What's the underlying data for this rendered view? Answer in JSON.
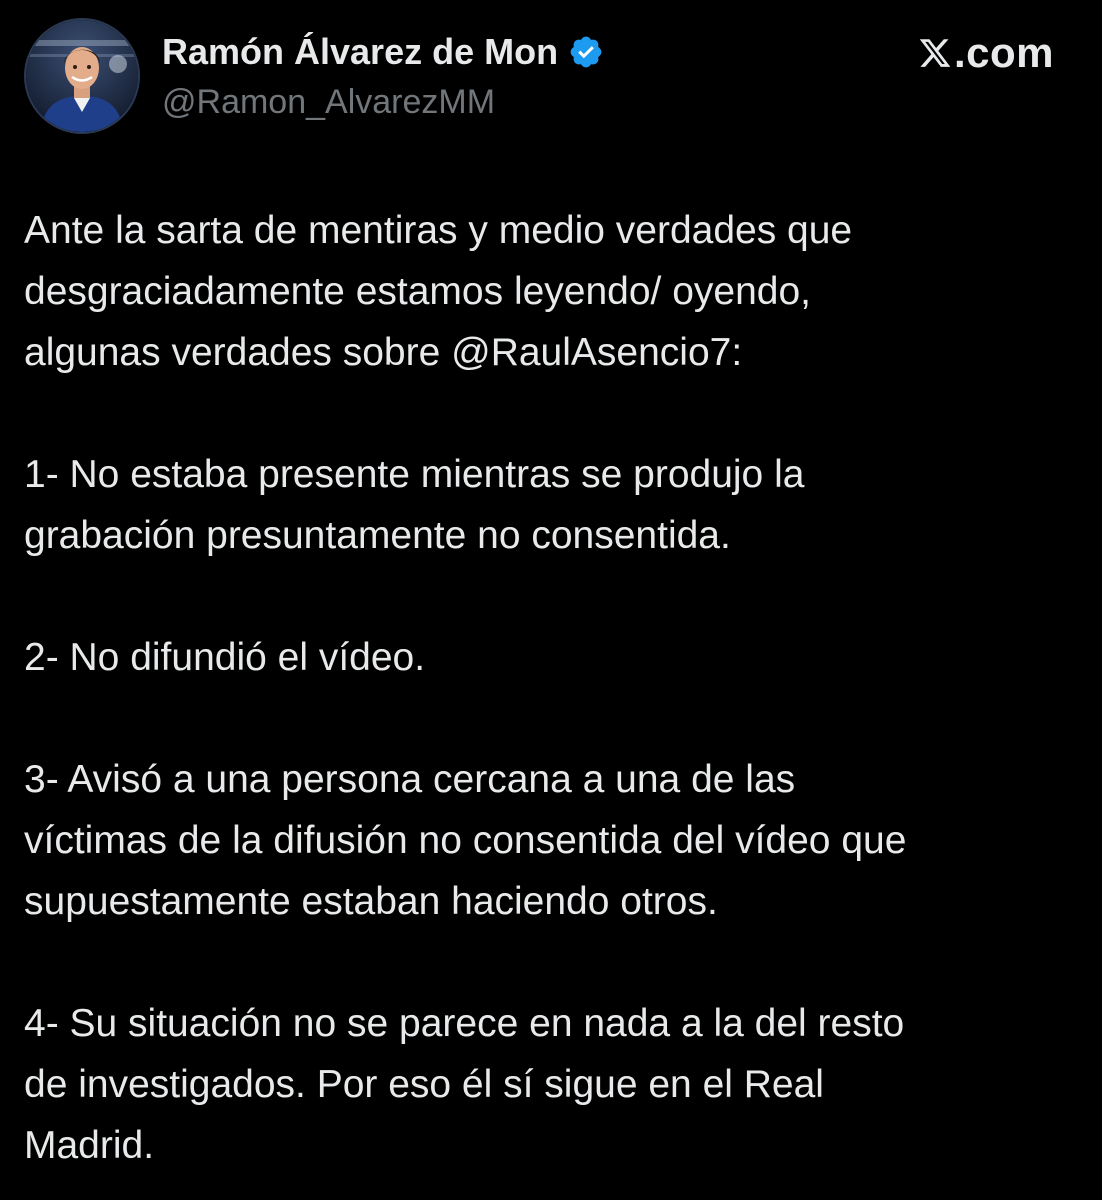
{
  "author": {
    "display_name": "Ramón Álvarez de Mon",
    "handle": "@Ramon_AlvarezMM",
    "verified_icon": "verified-badge-icon",
    "avatar": "profile-photo"
  },
  "brand": {
    "icon": "x-logo-icon",
    "label": ".com"
  },
  "tweet": {
    "paragraphs": [
      "Ante la sarta de mentiras y medio verdades que\ndesgraciadamente estamos leyendo/ oyendo,\nalgunas verdades sobre @RaulAsencio7:",
      "1- No estaba presente mientras se produjo la\ngrabación presuntamente no consentida.",
      "2- No difundió el vídeo.",
      "3- Avisó a una persona cercana a una de las\nvíctimas de la difusión no consentida del vídeo que\nsupuestamente estaban haciendo otros.",
      "4- Su situación no se parece en nada a la del resto\nde investigados. Por eso él sí sigue en el Real\nMadrid."
    ]
  },
  "colors": {
    "background": "#000000",
    "text_primary": "#e7e9ea",
    "text_secondary": "#71767b",
    "verified_blue": "#1d9bf0"
  }
}
